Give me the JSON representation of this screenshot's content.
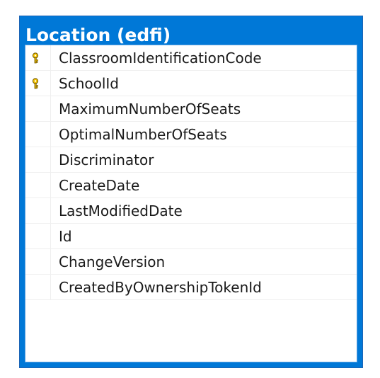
{
  "table": {
    "title": "Location (edfi)",
    "columns": [
      {
        "name": "ClassroomIdentificationCode",
        "icon": "primary-key-icon"
      },
      {
        "name": "SchoolId",
        "icon": "primary-key-icon"
      },
      {
        "name": "MaximumNumberOfSeats",
        "icon": ""
      },
      {
        "name": "OptimalNumberOfSeats",
        "icon": ""
      },
      {
        "name": "Discriminator",
        "icon": ""
      },
      {
        "name": "CreateDate",
        "icon": ""
      },
      {
        "name": "LastModifiedDate",
        "icon": ""
      },
      {
        "name": "Id",
        "icon": ""
      },
      {
        "name": "ChangeVersion",
        "icon": ""
      },
      {
        "name": "CreatedByOwnershipTokenId",
        "icon": ""
      }
    ]
  },
  "colors": {
    "header": "#0078d7",
    "key": "#e8b400"
  }
}
